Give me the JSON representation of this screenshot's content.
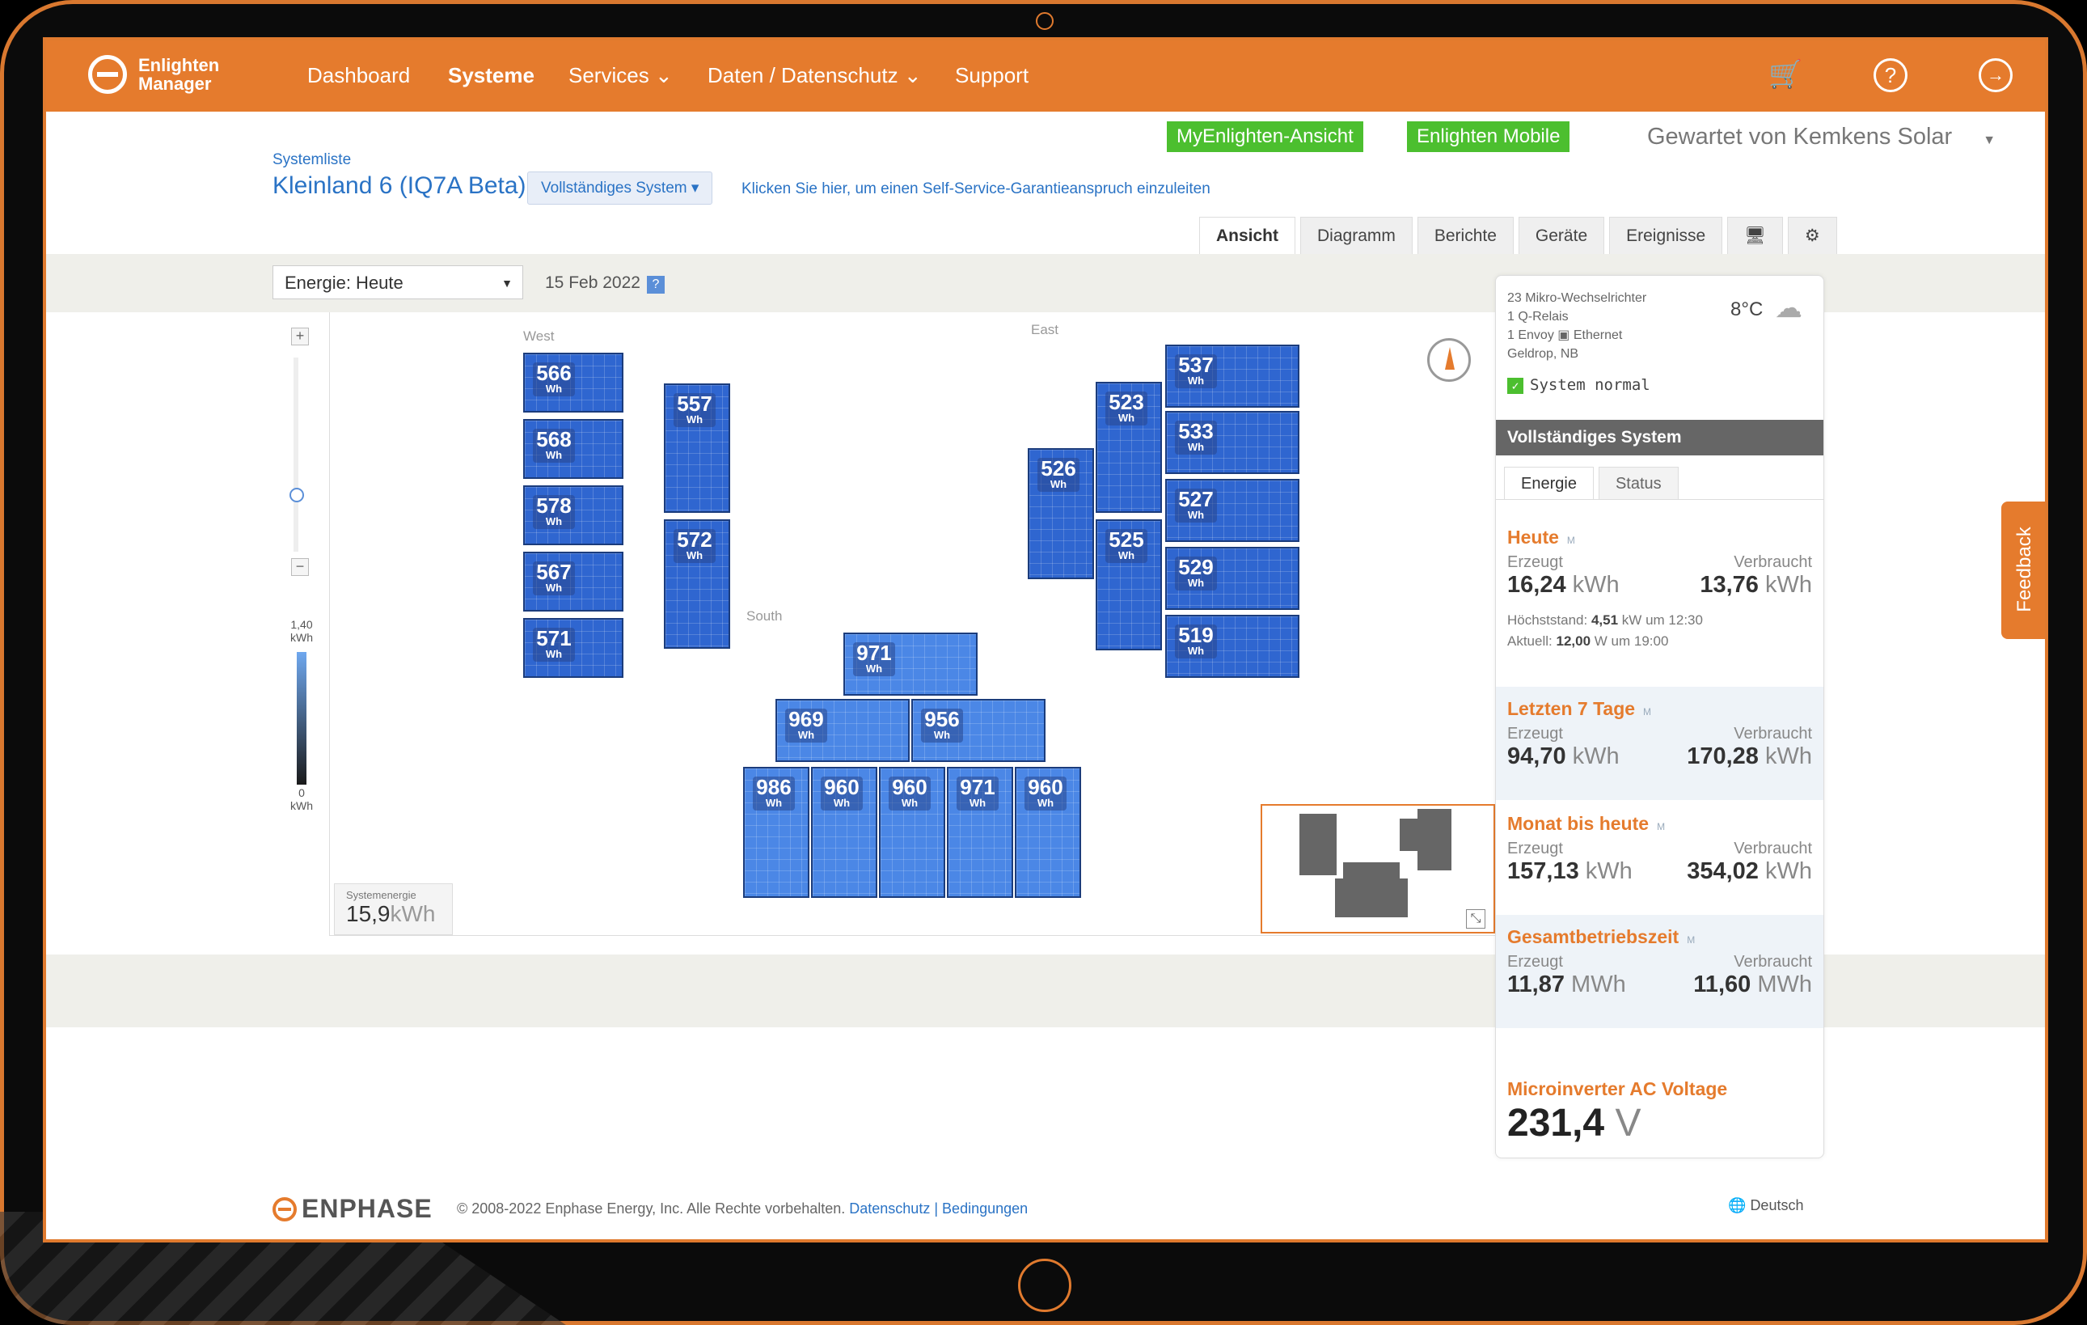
{
  "nav": {
    "logo_line1": "Enlighten",
    "logo_line2": "Manager",
    "items": [
      "Dashboard",
      "Systeme",
      "Services",
      "Daten / Datenschutz",
      "Support"
    ]
  },
  "header": {
    "breadcrumb": "Systemliste",
    "title": "Kleinland 6 (IQ7A Beta)",
    "system_dropdown": "Vollständiges System",
    "warranty_link": "Klicken Sie hier, um einen Self-Service-Garantieanspruch einzuleiten",
    "myenlighten": "MyEnlighten-Ansicht",
    "mobile": "Enlighten Mobile",
    "maintained_by": "Gewartet von Kemkens Solar"
  },
  "tabs": [
    "Ansicht",
    "Diagramm",
    "Berichte",
    "Geräte",
    "Ereignisse"
  ],
  "toolbar": {
    "energy_select": "Energie: Heute",
    "date": "15 Feb 2022",
    "help": "?"
  },
  "legend": {
    "max": "1,40",
    "max_unit": "kWh",
    "min": "0",
    "min_unit": "kWh"
  },
  "regions": {
    "west": "West",
    "east": "East",
    "south": "South"
  },
  "panel_unit": "Wh",
  "panels": {
    "w1": "566",
    "w2": "568",
    "w3": "578",
    "w4": "567",
    "w5": "571",
    "w6": "557",
    "w7": "572",
    "e1": "526",
    "e2": "523",
    "e3": "525",
    "e4": "537",
    "e5": "533",
    "e6": "527",
    "e7": "529",
    "e8": "519",
    "s1": "971",
    "s2": "969",
    "s3": "956",
    "s4": "986",
    "s5": "960",
    "s6": "960",
    "s7": "971",
    "s8": "960"
  },
  "system_energy": {
    "label": "Systemenergie",
    "value": "15,9",
    "unit": "kWh"
  },
  "info": {
    "line1": "23 Mikro-Wechselrichter",
    "line2": "1 Q-Relais",
    "line3_a": "1 Envoy",
    "line3_b": "Ethernet",
    "line4": "Geldrop, NB",
    "temp": "8°C",
    "status": "System normal"
  },
  "rp": {
    "head": "Vollständiges System",
    "tab_energy": "Energie",
    "tab_status": "Status",
    "produced": "Erzeugt",
    "consumed": "Verbraucht",
    "m": "M"
  },
  "stats": {
    "today": {
      "title": "Heute",
      "prod": "16,24",
      "prod_u": "kWh",
      "cons": "13,76",
      "cons_u": "kWh",
      "peak_label": "Höchststand:",
      "peak_val": "4,51",
      "peak_rest": "kW um 12:30",
      "cur_label": "Aktuell:",
      "cur_val": "12,00",
      "cur_rest": "W um 19:00"
    },
    "week": {
      "title": "Letzten 7 Tage",
      "prod": "94,70",
      "prod_u": "kWh",
      "cons": "170,28",
      "cons_u": "kWh"
    },
    "month": {
      "title": "Monat bis heute",
      "prod": "157,13",
      "prod_u": "kWh",
      "cons": "354,02",
      "cons_u": "kWh"
    },
    "total": {
      "title": "Gesamtbetriebszeit",
      "prod": "11,87",
      "prod_u": "MWh",
      "cons": "11,60",
      "cons_u": "MWh"
    }
  },
  "voltage": {
    "title": "Microinverter AC Voltage",
    "value": "231,4",
    "unit": "V"
  },
  "feedback": "Feedback",
  "footer": {
    "brand": "ENPHASE",
    "copyright": "© 2008-2022 Enphase Energy, Inc. Alle Rechte vorbehalten.",
    "privacy": "Datenschutz",
    "sep": "|",
    "terms": "Bedingungen",
    "language": "Deutsch"
  },
  "colors": {
    "brand": "#e57b2d",
    "link": "#2a73c5",
    "ok": "#4cbf2f"
  }
}
